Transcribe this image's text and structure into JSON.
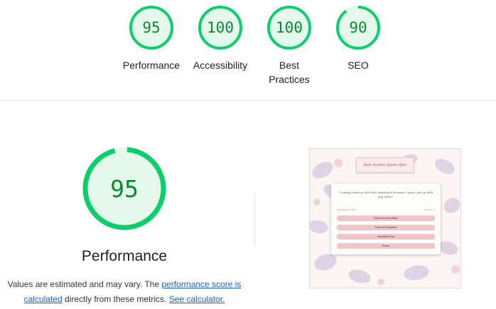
{
  "summary": {
    "scores": [
      {
        "label": "Performance",
        "value": "95"
      },
      {
        "label": "Accessibility",
        "value": "100"
      },
      {
        "label": "Best Practices",
        "value": "100"
      },
      {
        "label": "SEO",
        "value": "90"
      }
    ]
  },
  "detail": {
    "score": "95",
    "title": "Performance",
    "note": {
      "prefix": "Values are estimated and may vary. The ",
      "link1": "performance score is calculated",
      "middle": " directly from these metrics. ",
      "link2": "See calculator."
    }
  },
  "screenshot": {
    "quiz_title": "Jane Austen Quote Quiz",
    "quote": "\"I always deserve the best treatment because I never put up with any other.\"",
    "question_counter": "Question 1 of 8",
    "score_text": "Score: 0",
    "options": [
      "Sense and Sensibility",
      "Pride and Prejudice",
      "Mansfield Park",
      "Emma"
    ]
  },
  "colors": {
    "pass_green": "#0cce6b",
    "pass_fill": "#e5f8ec",
    "pass_text": "#0a8a2e",
    "link_blue": "#1a5fd0"
  }
}
